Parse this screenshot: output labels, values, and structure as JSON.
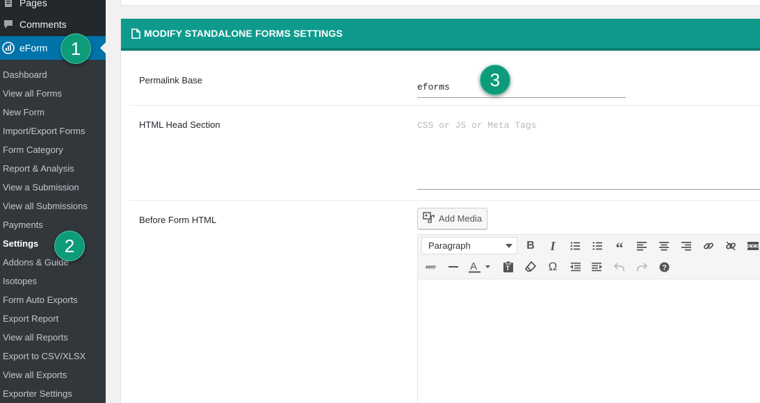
{
  "sidebar": {
    "pages_label": "Pages",
    "comments_label": "Comments",
    "eform_label": "eForm",
    "submenu": [
      "Dashboard",
      "View all Forms",
      "New Form",
      "Import/Export Forms",
      "Form Category",
      "Report & Analysis",
      "View a Submission",
      "View all Submissions",
      "Payments",
      "Settings",
      "Addons & Guide",
      "Isotopes",
      "Form Auto Exports",
      "Export Report",
      "View all Reports",
      "Export to CSV/XLSX",
      "View all Exports",
      "Exporter Settings"
    ]
  },
  "badges": {
    "one": "1",
    "two": "2",
    "three": "3"
  },
  "panel": {
    "title": "MODIFY STANDALONE FORMS SETTINGS",
    "permalink_label": "Permalink Base",
    "permalink_value": "eforms",
    "head_label": "HTML Head Section",
    "head_placeholder": "CSS or JS or Meta Tags",
    "before_label": "Before Form HTML",
    "add_media_label": "Add Media",
    "format_value": "Paragraph"
  },
  "toolbar_icons": [
    "bold-icon",
    "italic-icon",
    "bullet-list-icon",
    "numbered-list-icon",
    "blockquote-icon",
    "align-left-icon",
    "align-center-icon",
    "align-right-icon",
    "link-icon",
    "unlink-icon",
    "read-more-icon",
    "strikethrough-icon",
    "horizontal-line-icon",
    "text-color-icon",
    "paste-text-icon",
    "clear-formatting-icon",
    "special-character-icon",
    "outdent-icon",
    "indent-icon",
    "undo-icon",
    "redo-icon",
    "help-icon"
  ],
  "colors": {
    "sidebar": "#23282d",
    "submenu": "#32373c",
    "active": "#0073aa",
    "header": "#0e9b8d",
    "badge": "#0e9b7a"
  }
}
